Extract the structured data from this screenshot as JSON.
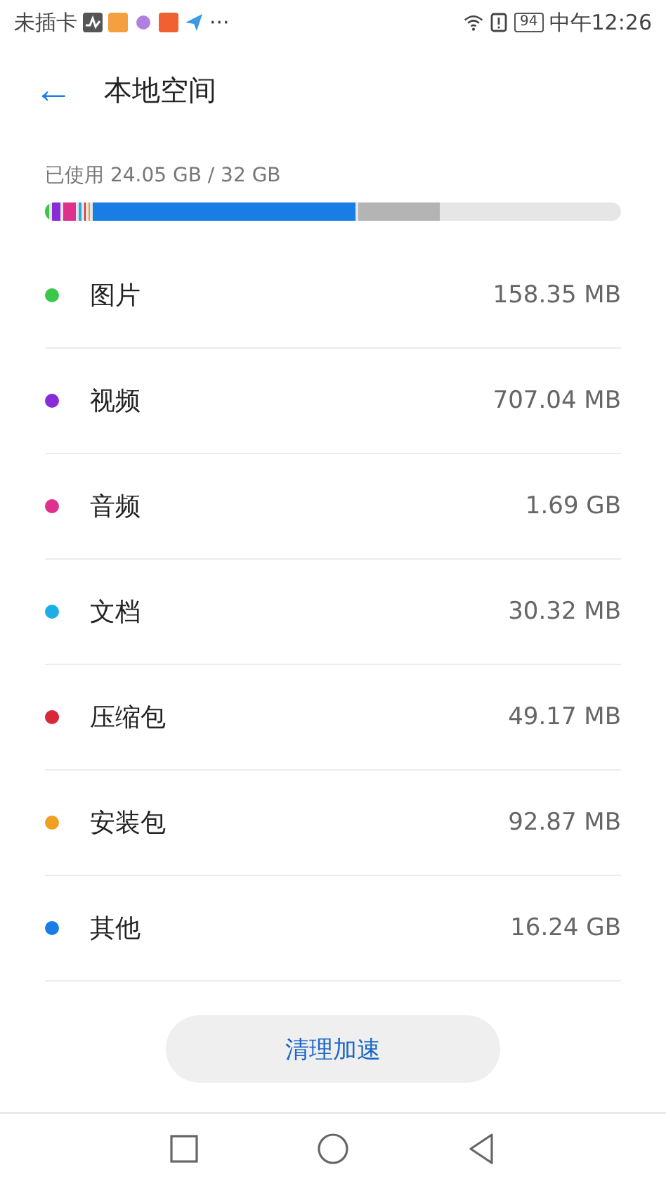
{
  "status_bar": {
    "carrier": "未插卡",
    "notifications": "···",
    "battery": "94",
    "time": "中午12:26"
  },
  "header": {
    "back": "←",
    "title": "本地空间"
  },
  "usage": {
    "label": "已使用 24.05 GB / 32 GB"
  },
  "categories": [
    {
      "name": "图片",
      "size": "158.35 MB",
      "color": "#3cc64a"
    },
    {
      "name": "视频",
      "size": "707.04 MB",
      "color": "#8a2bd8"
    },
    {
      "name": "音频",
      "size": "1.69 GB",
      "color": "#e0308e"
    },
    {
      "name": "文档",
      "size": "30.32 MB",
      "color": "#1eaee6"
    },
    {
      "name": "压缩包",
      "size": "49.17 MB",
      "color": "#d8283a"
    },
    {
      "name": "安装包",
      "size": "92.87 MB",
      "color": "#f0a020"
    },
    {
      "name": "其他",
      "size": "16.24 GB",
      "color": "#1a7de6"
    }
  ],
  "clean_button": "清理加速"
}
